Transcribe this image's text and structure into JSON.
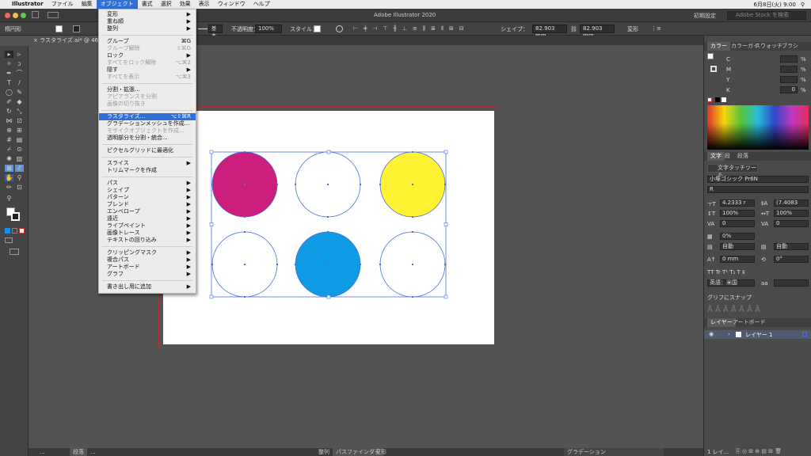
{
  "menubar": {
    "apple": "",
    "items": [
      "Illustrator",
      "ファイル",
      "編集",
      "オブジェクト",
      "書式",
      "選択",
      "効果",
      "表示",
      "ウィンドウ",
      "ヘルプ"
    ],
    "clock": "6月8日(火) 9:00"
  },
  "titlebar": {
    "title": "Adobe Illustrator 2020",
    "workspace": "初期設定",
    "search_placeholder": "Adobe Stock を検索"
  },
  "control": {
    "shape_label": "楕円形",
    "stroke_label": "基本",
    "opacity_label": "不透明度：",
    "opacity_value": "100%",
    "style_label": "スタイル：",
    "shape_prop": "シェイプ：",
    "width": "82.903 mm",
    "height": "82.903 mm",
    "transform": "変形"
  },
  "document_tab": {
    "label": "ラスタライズ.ai* @ 46.6% (C"
  },
  "menu": {
    "items": [
      {
        "label": "変形",
        "arrow": "▶"
      },
      {
        "label": "重ね順",
        "arrow": "▶"
      },
      {
        "label": "整列",
        "arrow": "▶"
      },
      {
        "label": "グループ",
        "sc": "⌘G"
      },
      {
        "label": "グループ解除",
        "sc": "⇧⌘G",
        "dis": true
      },
      {
        "label": "ロック",
        "arrow": "▶"
      },
      {
        "label": "すべてをロック解除",
        "sc": "⌥⌘2",
        "dis": true
      },
      {
        "label": "隠す",
        "arrow": "▶"
      },
      {
        "label": "すべてを表示",
        "sc": "⌥⌘3",
        "dis": true
      },
      {
        "label": "分割・拡張..."
      },
      {
        "label": "アピアランスを分割",
        "dis": true
      },
      {
        "label": "画像の切り抜き",
        "dis": true
      },
      {
        "label": "ラスタライズ...",
        "sc": "⌥⇧⌘R",
        "hl": true
      },
      {
        "label": "グラデーションメッシュを作成..."
      },
      {
        "label": "モザイクオブジェクトを作成...",
        "dis": true
      },
      {
        "label": "透明部分を分割・統合..."
      },
      {
        "label": "ピクセルグリッドに最適化"
      },
      {
        "label": "スライス",
        "arrow": "▶"
      },
      {
        "label": "トリムマークを作成"
      },
      {
        "label": "パス",
        "arrow": "▶"
      },
      {
        "label": "シェイプ",
        "arrow": "▶"
      },
      {
        "label": "パターン",
        "arrow": "▶"
      },
      {
        "label": "ブレンド",
        "arrow": "▶"
      },
      {
        "label": "エンベロープ",
        "arrow": "▶"
      },
      {
        "label": "遠近",
        "arrow": "▶"
      },
      {
        "label": "ライブペイント",
        "arrow": "▶"
      },
      {
        "label": "画像トレース",
        "arrow": "▶"
      },
      {
        "label": "テキストの回り込み",
        "arrow": "▶"
      },
      {
        "label": "クリッピングマスク",
        "arrow": "▶"
      },
      {
        "label": "複合パス",
        "arrow": "▶"
      },
      {
        "label": "アートボード",
        "arrow": "▶"
      },
      {
        "label": "グラフ",
        "arrow": "▶"
      },
      {
        "label": "書き出し用に追加",
        "arrow": "▶"
      }
    ]
  },
  "color_panel": {
    "tabs": [
      "カラー",
      "カラーガイ",
      "スウォッチ",
      "ブラシ"
    ],
    "channels": [
      {
        "name": "C",
        "value": "",
        "unit": "%"
      },
      {
        "name": "M",
        "value": "",
        "unit": "%"
      },
      {
        "name": "Y",
        "value": "",
        "unit": "%"
      },
      {
        "name": "K",
        "value": "0",
        "unit": "%"
      }
    ]
  },
  "char_panel": {
    "tabs": [
      "文字",
      "段",
      "段落"
    ],
    "touch_type": "文字タッチツール",
    "font": "小塚ゴシック Pr6N",
    "style": "R",
    "size": "4.2333 r",
    "leading": "(7.4083",
    "hscale": "100%",
    "vscale": "100%",
    "kerning": "0",
    "tracking": "0",
    "tsume": "0%",
    "aki1": "自動",
    "aki2": "自動",
    "baseline": "0 mm",
    "rotate": "0°",
    "lang": "英語：米国",
    "glyph_snap": "グリフにスナップ"
  },
  "layers_panel": {
    "tabs": [
      "レイヤー",
      "アートボード"
    ],
    "layer": "レイヤー 1",
    "footer": "1 レイ..."
  },
  "circles": [
    {
      "fill": "#cc1f7d"
    },
    {
      "fill": "#ffffff"
    },
    {
      "fill": "#fff233"
    },
    {
      "fill": "#ffffff"
    },
    {
      "fill": "#0f9be3"
    },
    {
      "fill": "#ffffff"
    }
  ],
  "bottom": {
    "tabs_left": [
      "...",
      "段落",
      "..."
    ],
    "tabs_mid": [
      "整列",
      "パスファインダー",
      "変形"
    ],
    "gradient": "グラデーション"
  }
}
